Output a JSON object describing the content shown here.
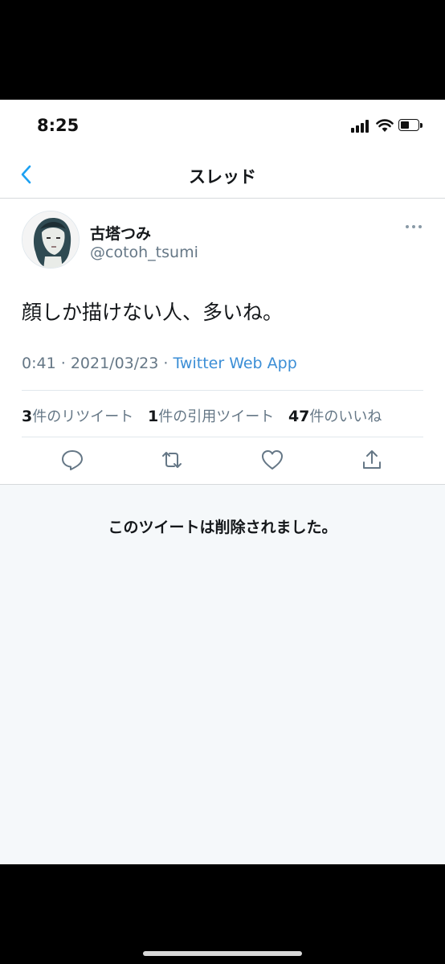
{
  "status_bar": {
    "time": "8:25"
  },
  "nav": {
    "title": "スレッド"
  },
  "tweet": {
    "display_name": "古塔つみ",
    "handle": "@cotoh_tsumi",
    "text": "顔しか描けない人、多いね。",
    "time": "0:41",
    "date": "2021/03/23",
    "source": "Twitter Web App",
    "separator": "·",
    "stats": {
      "retweets_count": "3",
      "retweets_label": "件のリツイート",
      "quotes_count": "1",
      "quotes_label": "件の引用ツイート",
      "likes_count": "47",
      "likes_label": "件のいいね"
    }
  },
  "deleted_notice": "このツイートは削除されました。",
  "colors": {
    "accent": "#1da1f2",
    "text_primary": "#14171a",
    "text_secondary": "#657786",
    "background_secondary": "#f5f8fa"
  },
  "icons": [
    "back-chevron-icon",
    "more-icon",
    "reply-icon",
    "retweet-icon",
    "like-icon",
    "share-icon",
    "signal-icon",
    "wifi-icon",
    "battery-icon"
  ]
}
